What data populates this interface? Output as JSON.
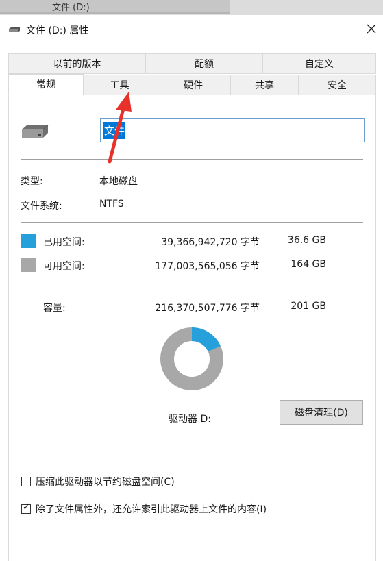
{
  "background_window": {
    "title": "文件 (D:)"
  },
  "dialog": {
    "title": "文件 (D:) 属性",
    "close_icon": "close-icon"
  },
  "tabs": {
    "row1": [
      "以前的版本",
      "配额",
      "自定义"
    ],
    "row2": [
      "常规",
      "工具",
      "硬件",
      "共享",
      "安全"
    ],
    "active": "常规"
  },
  "general": {
    "drive_icon": "drive-icon",
    "name_value": "文件",
    "type_label": "类型:",
    "type_value": "本地磁盘",
    "fs_label": "文件系统:",
    "fs_value": "NTFS",
    "used_label": "已用空间:",
    "used_bytes": "39,366,942,720 字节",
    "used_size": "36.6 GB",
    "free_label": "可用空间:",
    "free_bytes": "177,003,565,056 字节",
    "free_size": "164 GB",
    "capacity_label": "容量:",
    "capacity_bytes": "216,370,507,776 字节",
    "capacity_size": "201 GB",
    "drive_label": "驱动器 D:",
    "cleanup_button": "磁盘清理(D)",
    "used_fraction": 0.182,
    "colors": {
      "used": "#26a0da",
      "free": "#a8a8a8"
    }
  },
  "options": {
    "compress_label": "压缩此驱动器以节约磁盘空间(C)",
    "compress_checked": false,
    "index_label": "除了文件属性外，还允许索引此驱动器上文件的内容(I)",
    "index_checked": true
  },
  "annotation": {
    "arrow_color": "#e8312a"
  }
}
